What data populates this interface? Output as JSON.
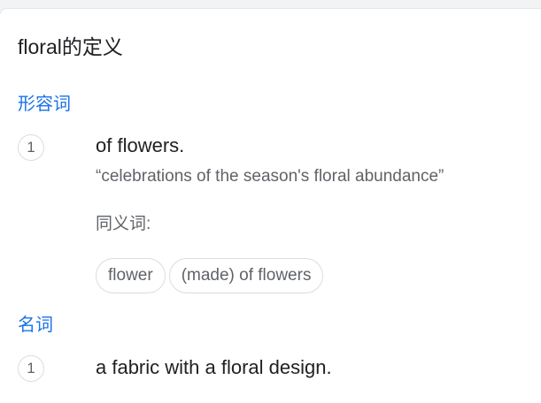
{
  "title": "floral的定义",
  "sections": [
    {
      "pos": "形容词",
      "senses": [
        {
          "number": "1",
          "definition": "of flowers.",
          "example": "“celebrations of the season's floral abundance”",
          "synonyms_label": "同义词:",
          "synonyms": [
            "flower",
            "(made) of flowers"
          ]
        }
      ]
    },
    {
      "pos": "名词",
      "senses": [
        {
          "number": "1",
          "definition": "a fabric with a floral design."
        }
      ]
    }
  ]
}
